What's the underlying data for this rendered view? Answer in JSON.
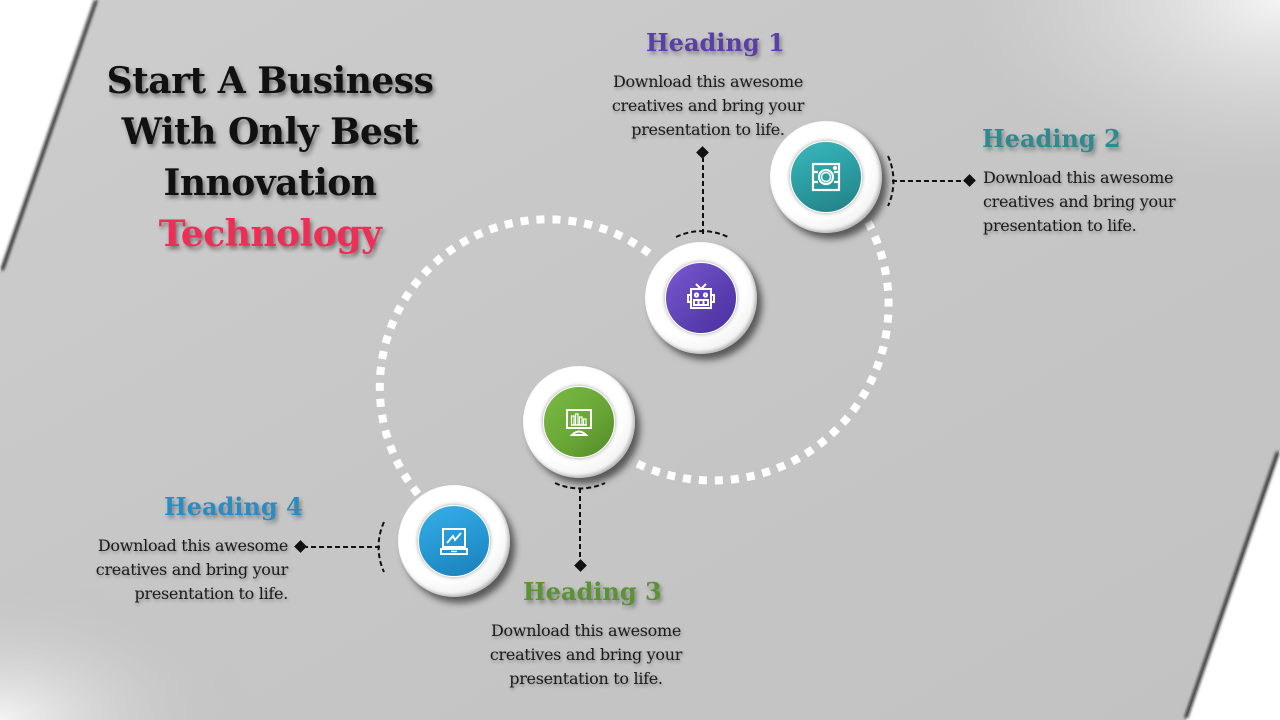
{
  "slide": {
    "title_lines": [
      "Start A Business",
      "With Only Best",
      "Innovation"
    ],
    "title_accent": "Technology",
    "colors": {
      "background": "#c8c8c8",
      "title": "#111111",
      "accent": "#ef2e55",
      "dotted_path": "#ffffff"
    },
    "steps": [
      {
        "heading": "Heading 1",
        "color": "#5a3fa8",
        "icon": "robot-icon",
        "description_lines": [
          "Download this awesome",
          "creatives and bring your",
          "presentation to life."
        ]
      },
      {
        "heading": "Heading 2",
        "color": "#2e8a8f",
        "icon": "camera-icon",
        "description_lines": [
          "Download this awesome",
          "creatives and bring your",
          "presentation to life."
        ]
      },
      {
        "heading": "Heading 3",
        "color": "#5a9234",
        "icon": "bar-chart-monitor-icon",
        "description_lines": [
          "Download this awesome",
          "creatives and bring your",
          "presentation to life."
        ]
      },
      {
        "heading": "Heading 4",
        "color": "#2b8cc4",
        "icon": "laptop-chart-icon",
        "description_lines": [
          "Download this awesome",
          "creatives and bring your",
          "presentation to life."
        ]
      }
    ]
  }
}
